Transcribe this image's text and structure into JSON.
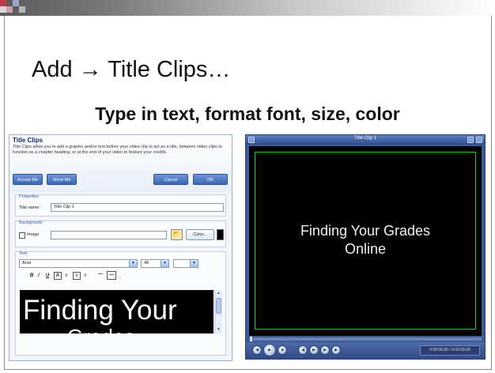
{
  "slide": {
    "title": "Add → Title Clips…",
    "subtitle": "Type in text, format font, size, color"
  },
  "dialog": {
    "title": "Title Clips",
    "description": "Title Clips allow you to add a graphic and/or text before your video clip to act as a title, between video clips to function as a chapter heading, or at the end of your video to feature your credits.",
    "buttons": {
      "accept_label": "Accept Me",
      "show_label": "Show Me",
      "cancel_label": "Cancel",
      "ok_label": "OK"
    },
    "properties": {
      "group_label": "Properties",
      "title_name_label": "Title name:",
      "title_name_value": "Title Clip 1"
    },
    "background": {
      "group_label": "Background",
      "image_label": "Image",
      "image_checked": false,
      "color_button_label": "Color...",
      "color_swatch": "#000000"
    },
    "text": {
      "group_label": "Text",
      "font_value": "Arial",
      "size_value": "48",
      "text_color": "#ffffff",
      "format_buttons": [
        "B",
        "/",
        "U",
        "A",
        "≡",
        "≡",
        "≡",
        "—",
        "—",
        "_"
      ],
      "preview_line1": "Finding Your",
      "preview_line2": "Grades"
    }
  },
  "player": {
    "title": "Title Clip 1",
    "text_line1": "Finding Your Grades",
    "text_line2": "Online",
    "time": "0:00:00.00 / 0:00:00.00",
    "accent": "#18d01a"
  }
}
